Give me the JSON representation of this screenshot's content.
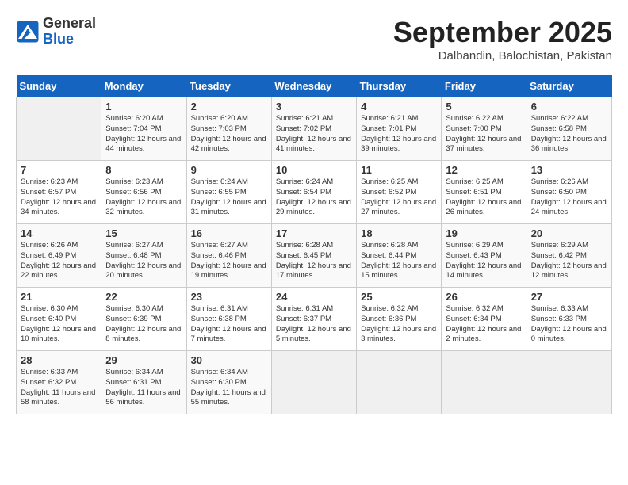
{
  "header": {
    "logo_general": "General",
    "logo_blue": "Blue",
    "month": "September 2025",
    "location": "Dalbandin, Balochistan, Pakistan"
  },
  "weekdays": [
    "Sunday",
    "Monday",
    "Tuesday",
    "Wednesday",
    "Thursday",
    "Friday",
    "Saturday"
  ],
  "weeks": [
    [
      {
        "day": null
      },
      {
        "day": "1",
        "sunrise": "6:20 AM",
        "sunset": "7:04 PM",
        "daylight": "12 hours and 44 minutes."
      },
      {
        "day": "2",
        "sunrise": "6:20 AM",
        "sunset": "7:03 PM",
        "daylight": "12 hours and 42 minutes."
      },
      {
        "day": "3",
        "sunrise": "6:21 AM",
        "sunset": "7:02 PM",
        "daylight": "12 hours and 41 minutes."
      },
      {
        "day": "4",
        "sunrise": "6:21 AM",
        "sunset": "7:01 PM",
        "daylight": "12 hours and 39 minutes."
      },
      {
        "day": "5",
        "sunrise": "6:22 AM",
        "sunset": "7:00 PM",
        "daylight": "12 hours and 37 minutes."
      },
      {
        "day": "6",
        "sunrise": "6:22 AM",
        "sunset": "6:58 PM",
        "daylight": "12 hours and 36 minutes."
      }
    ],
    [
      {
        "day": "7",
        "sunrise": "6:23 AM",
        "sunset": "6:57 PM",
        "daylight": "12 hours and 34 minutes."
      },
      {
        "day": "8",
        "sunrise": "6:23 AM",
        "sunset": "6:56 PM",
        "daylight": "12 hours and 32 minutes."
      },
      {
        "day": "9",
        "sunrise": "6:24 AM",
        "sunset": "6:55 PM",
        "daylight": "12 hours and 31 minutes."
      },
      {
        "day": "10",
        "sunrise": "6:24 AM",
        "sunset": "6:54 PM",
        "daylight": "12 hours and 29 minutes."
      },
      {
        "day": "11",
        "sunrise": "6:25 AM",
        "sunset": "6:52 PM",
        "daylight": "12 hours and 27 minutes."
      },
      {
        "day": "12",
        "sunrise": "6:25 AM",
        "sunset": "6:51 PM",
        "daylight": "12 hours and 26 minutes."
      },
      {
        "day": "13",
        "sunrise": "6:26 AM",
        "sunset": "6:50 PM",
        "daylight": "12 hours and 24 minutes."
      }
    ],
    [
      {
        "day": "14",
        "sunrise": "6:26 AM",
        "sunset": "6:49 PM",
        "daylight": "12 hours and 22 minutes."
      },
      {
        "day": "15",
        "sunrise": "6:27 AM",
        "sunset": "6:48 PM",
        "daylight": "12 hours and 20 minutes."
      },
      {
        "day": "16",
        "sunrise": "6:27 AM",
        "sunset": "6:46 PM",
        "daylight": "12 hours and 19 minutes."
      },
      {
        "day": "17",
        "sunrise": "6:28 AM",
        "sunset": "6:45 PM",
        "daylight": "12 hours and 17 minutes."
      },
      {
        "day": "18",
        "sunrise": "6:28 AM",
        "sunset": "6:44 PM",
        "daylight": "12 hours and 15 minutes."
      },
      {
        "day": "19",
        "sunrise": "6:29 AM",
        "sunset": "6:43 PM",
        "daylight": "12 hours and 14 minutes."
      },
      {
        "day": "20",
        "sunrise": "6:29 AM",
        "sunset": "6:42 PM",
        "daylight": "12 hours and 12 minutes."
      }
    ],
    [
      {
        "day": "21",
        "sunrise": "6:30 AM",
        "sunset": "6:40 PM",
        "daylight": "12 hours and 10 minutes."
      },
      {
        "day": "22",
        "sunrise": "6:30 AM",
        "sunset": "6:39 PM",
        "daylight": "12 hours and 8 minutes."
      },
      {
        "day": "23",
        "sunrise": "6:31 AM",
        "sunset": "6:38 PM",
        "daylight": "12 hours and 7 minutes."
      },
      {
        "day": "24",
        "sunrise": "6:31 AM",
        "sunset": "6:37 PM",
        "daylight": "12 hours and 5 minutes."
      },
      {
        "day": "25",
        "sunrise": "6:32 AM",
        "sunset": "6:36 PM",
        "daylight": "12 hours and 3 minutes."
      },
      {
        "day": "26",
        "sunrise": "6:32 AM",
        "sunset": "6:34 PM",
        "daylight": "12 hours and 2 minutes."
      },
      {
        "day": "27",
        "sunrise": "6:33 AM",
        "sunset": "6:33 PM",
        "daylight": "12 hours and 0 minutes."
      }
    ],
    [
      {
        "day": "28",
        "sunrise": "6:33 AM",
        "sunset": "6:32 PM",
        "daylight": "11 hours and 58 minutes."
      },
      {
        "day": "29",
        "sunrise": "6:34 AM",
        "sunset": "6:31 PM",
        "daylight": "11 hours and 56 minutes."
      },
      {
        "day": "30",
        "sunrise": "6:34 AM",
        "sunset": "6:30 PM",
        "daylight": "11 hours and 55 minutes."
      },
      {
        "day": null
      },
      {
        "day": null
      },
      {
        "day": null
      },
      {
        "day": null
      }
    ]
  ]
}
